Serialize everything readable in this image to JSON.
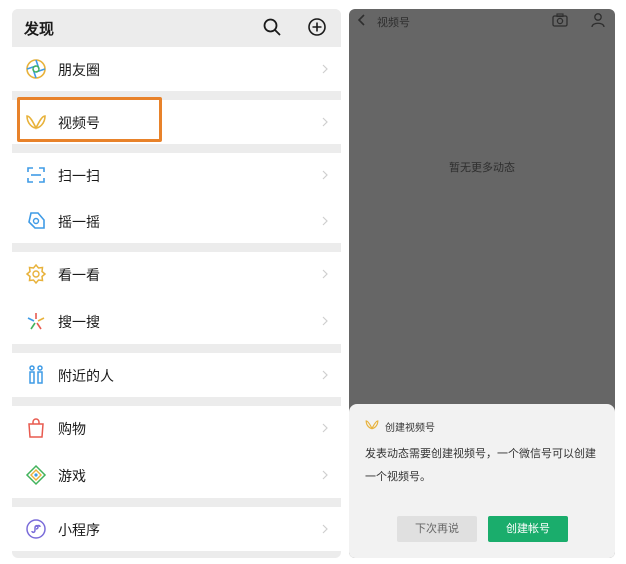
{
  "left": {
    "title": "发现",
    "items": [
      {
        "label": "朋友圈",
        "icon": "moments-icon"
      },
      {
        "label": "视频号",
        "icon": "channels-icon"
      },
      {
        "label": "扫一扫",
        "icon": "scan-icon"
      },
      {
        "label": "摇一摇",
        "icon": "shake-icon"
      },
      {
        "label": "看一看",
        "icon": "top-stories-icon"
      },
      {
        "label": "搜一搜",
        "icon": "search-sparkle-icon"
      },
      {
        "label": "附近的人",
        "icon": "people-nearby-icon"
      },
      {
        "label": "购物",
        "icon": "shopping-bag-icon"
      },
      {
        "label": "游戏",
        "icon": "games-icon"
      },
      {
        "label": "小程序",
        "icon": "mini-program-icon"
      }
    ]
  },
  "right": {
    "title": "视频号",
    "empty_text": "暂无更多动态",
    "sheet": {
      "title": "创建视频号",
      "description": "发表动态需要创建视频号，一个微信号可以创建一个视频号。",
      "later_label": "下次再说",
      "create_label": "创建帐号"
    }
  },
  "colors": {
    "highlight": "#e8822a",
    "accent_green": "#1aad6c",
    "overlay": "#666666"
  }
}
